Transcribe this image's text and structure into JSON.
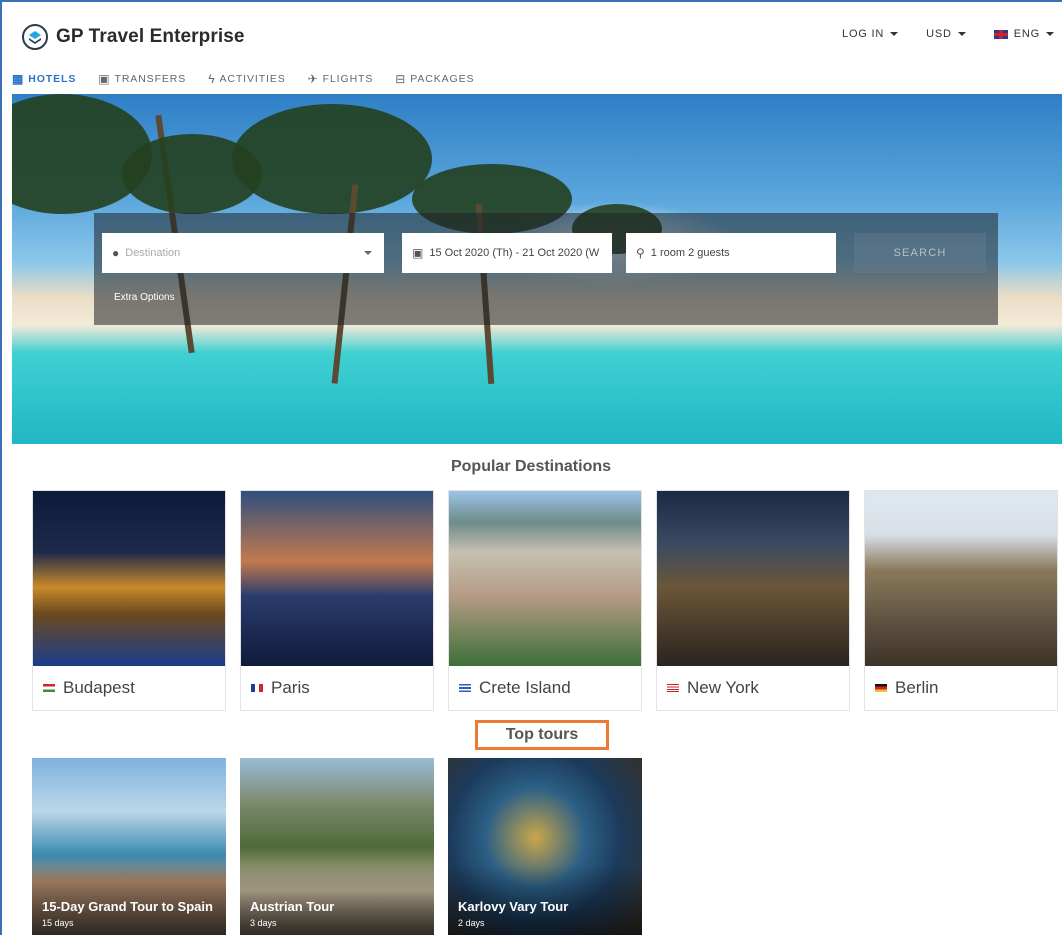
{
  "header": {
    "brand": "GP Travel Enterprise",
    "login": "LOG IN",
    "currency": "USD",
    "language": "ENG"
  },
  "tabs": [
    {
      "label": "HOTELS",
      "icon": "building-icon",
      "active": true
    },
    {
      "label": "TRANSFERS",
      "icon": "bus-icon",
      "active": false
    },
    {
      "label": "ACTIVITIES",
      "icon": "lightning-icon",
      "active": false
    },
    {
      "label": "FLIGHTS",
      "icon": "plane-icon",
      "active": false
    },
    {
      "label": "PACKAGES",
      "icon": "suitcase-icon",
      "active": false
    }
  ],
  "search": {
    "destination_placeholder": "Destination",
    "dates": "15 Oct 2020 (Th) - 21 Oct 2020 (W",
    "guests": "1 room 2 guests",
    "button": "SEARCH",
    "extra": "Extra Options"
  },
  "popular": {
    "title": "Popular Destinations",
    "items": [
      {
        "name": "Budapest",
        "flag": "hungary"
      },
      {
        "name": "Paris",
        "flag": "france"
      },
      {
        "name": "Crete Island",
        "flag": "greece"
      },
      {
        "name": "New York",
        "flag": "usa"
      },
      {
        "name": "Berlin",
        "flag": "germany"
      }
    ]
  },
  "tours": {
    "title": "Top tours",
    "items": [
      {
        "name": "15-Day Grand Tour to Spain",
        "days": "15 days"
      },
      {
        "name": "Austrian Tour",
        "days": "3 days"
      },
      {
        "name": "Karlovy Vary Tour",
        "days": "2 days"
      }
    ]
  },
  "colors": {
    "accent": "#2a73c9",
    "highlight": "#ec7a33"
  }
}
